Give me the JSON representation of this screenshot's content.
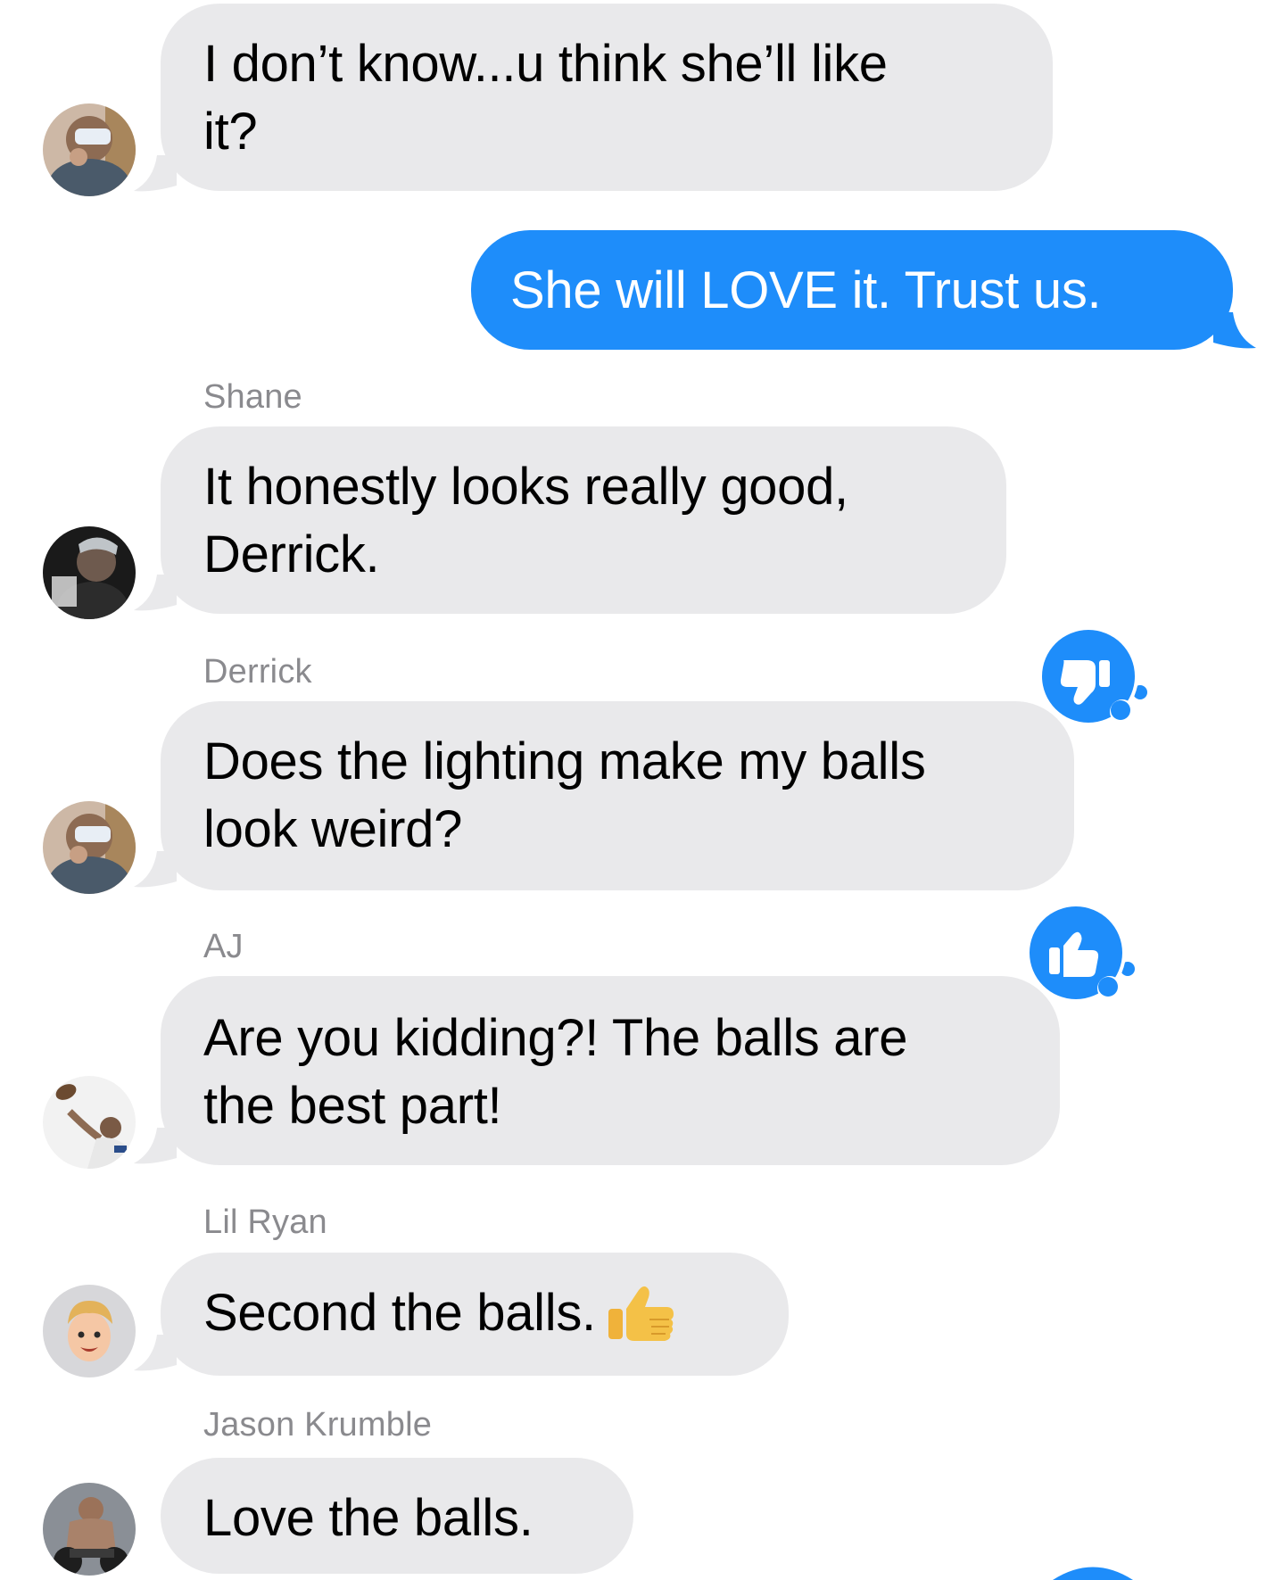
{
  "conversation": {
    "messages": [
      {
        "sender": "",
        "side": "in",
        "lines": [
          "I don’t know...u think she’ll like",
          "it?"
        ]
      },
      {
        "sender": "",
        "side": "out",
        "lines": [
          "She will LOVE it. Trust us."
        ]
      },
      {
        "sender": "Shane",
        "side": "in",
        "lines": [
          "It honestly looks really good,",
          "Derrick."
        ]
      },
      {
        "sender": "Derrick",
        "side": "in",
        "lines": [
          "Does the lighting make my balls",
          "look weird?"
        ],
        "reaction": "thumbs-down-icon"
      },
      {
        "sender": "AJ",
        "side": "in",
        "lines": [
          "Are you kidding?! The balls are",
          "the best part!"
        ],
        "reaction": "thumbs-up-icon"
      },
      {
        "sender": "Lil Ryan",
        "side": "in",
        "lines": [
          "Second the balls."
        ],
        "emoji": "thumbs-up-emoji"
      },
      {
        "sender": "Jason Krumble",
        "side": "in",
        "lines": [
          "Love the balls."
        ]
      }
    ]
  },
  "colors": {
    "incoming_bubble": "#e9e9eb",
    "outgoing_bubble": "#1e8dfa",
    "sender_name": "#8a8a8e",
    "reaction": "#1e8dfa"
  }
}
